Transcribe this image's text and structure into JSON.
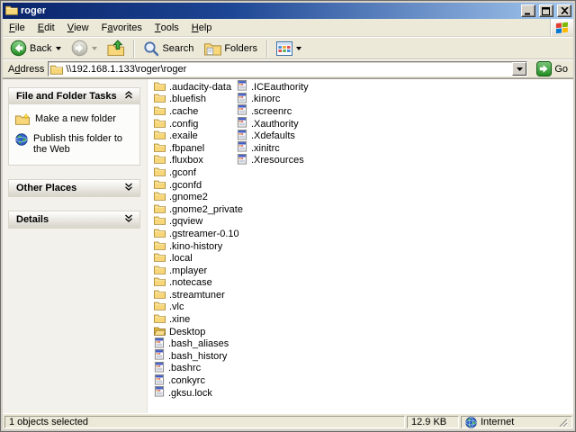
{
  "window": {
    "title": "roger"
  },
  "menu": {
    "items": [
      {
        "label": "File",
        "accel": 0
      },
      {
        "label": "Edit",
        "accel": 0
      },
      {
        "label": "View",
        "accel": 0
      },
      {
        "label": "Favorites",
        "accel": 1
      },
      {
        "label": "Tools",
        "accel": 0
      },
      {
        "label": "Help",
        "accel": 0
      }
    ]
  },
  "toolbar": {
    "back_label": "Back",
    "search_label": "Search",
    "folders_label": "Folders"
  },
  "address": {
    "label": "Address",
    "accel": 1,
    "value": "\\\\192.168.1.133\\roger\\roger",
    "go_label": "Go"
  },
  "sidebar": {
    "panels": [
      {
        "title": "File and Folder Tasks",
        "collapsed": false,
        "items": [
          {
            "label": "Make a new folder",
            "icon": "new-folder-icon"
          },
          {
            "label": "Publish this folder to the Web",
            "icon": "publish-web-icon"
          }
        ]
      },
      {
        "title": "Other Places",
        "collapsed": true,
        "items": []
      },
      {
        "title": "Details",
        "collapsed": true,
        "items": []
      }
    ]
  },
  "files": {
    "column1": [
      {
        "name": ".audacity-data",
        "type": "folder"
      },
      {
        "name": ".bluefish",
        "type": "folder"
      },
      {
        "name": ".cache",
        "type": "folder"
      },
      {
        "name": ".config",
        "type": "folder"
      },
      {
        "name": ".exaile",
        "type": "folder"
      },
      {
        "name": ".fbpanel",
        "type": "folder"
      },
      {
        "name": ".fluxbox",
        "type": "folder"
      },
      {
        "name": ".gconf",
        "type": "folder"
      },
      {
        "name": ".gconfd",
        "type": "folder"
      },
      {
        "name": ".gnome2",
        "type": "folder"
      },
      {
        "name": ".gnome2_private",
        "type": "folder"
      },
      {
        "name": ".gqview",
        "type": "folder"
      },
      {
        "name": ".gstreamer-0.10",
        "type": "folder"
      },
      {
        "name": ".kino-history",
        "type": "folder"
      },
      {
        "name": ".local",
        "type": "folder"
      },
      {
        "name": ".mplayer",
        "type": "folder"
      },
      {
        "name": ".notecase",
        "type": "folder"
      },
      {
        "name": ".streamtuner",
        "type": "folder"
      },
      {
        "name": ".vlc",
        "type": "folder"
      },
      {
        "name": ".xine",
        "type": "folder"
      },
      {
        "name": "Desktop",
        "type": "folder-open"
      },
      {
        "name": ".bash_aliases",
        "type": "config"
      },
      {
        "name": ".bash_history",
        "type": "config"
      },
      {
        "name": ".bashrc",
        "type": "config"
      },
      {
        "name": ".conkyrc",
        "type": "config"
      },
      {
        "name": ".gksu.lock",
        "type": "config"
      }
    ],
    "column2": [
      {
        "name": ".ICEauthority",
        "type": "config"
      },
      {
        "name": ".kinorc",
        "type": "config"
      },
      {
        "name": ".screenrc",
        "type": "config"
      },
      {
        "name": ".Xauthority",
        "type": "config"
      },
      {
        "name": ".Xdefaults",
        "type": "config"
      },
      {
        "name": ".xinitrc",
        "type": "config"
      },
      {
        "name": ".Xresources",
        "type": "config"
      }
    ]
  },
  "statusbar": {
    "selection": "1 objects selected",
    "size": "12.9 KB",
    "zone": "Internet"
  },
  "colors": {
    "title_gradient_start": "#0a246a",
    "title_gradient_end": "#a6caf0",
    "chrome": "#ece9d8",
    "folder_yellow": "#f8d77b",
    "go_green": "#2f9e2f"
  }
}
